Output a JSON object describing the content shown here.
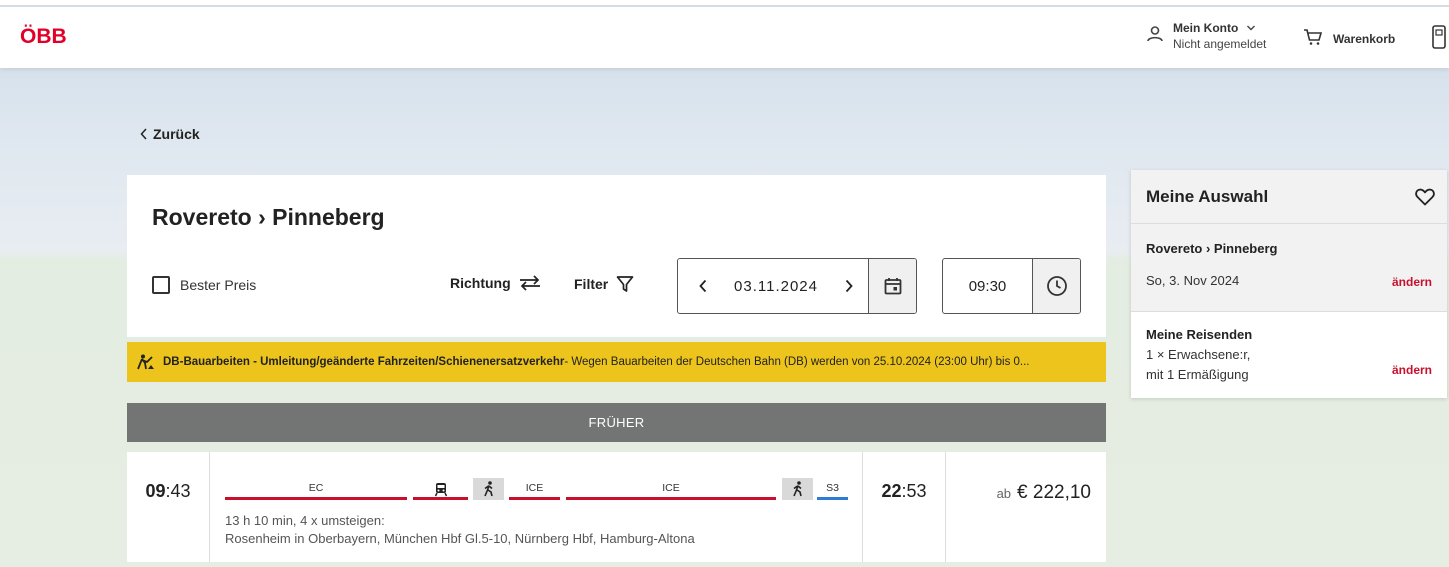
{
  "header": {
    "logo": "ÖBB",
    "account_label": "Mein Konto",
    "account_status": "Nicht angemeldet",
    "cart_label": "Warenkorb"
  },
  "nav": {
    "back_label": "Zurück"
  },
  "search": {
    "route_title": "Rovereto › Pinneberg",
    "best_price_label": "Bester Preis",
    "direction_label": "Richtung",
    "filter_label": "Filter",
    "date": "03.11.2024",
    "time": "09:30"
  },
  "alert": {
    "title": "DB-Bauarbeiten - Umleitung/geänderte Fahrzeiten/Schienenersatzverkehr",
    "text": " - Wegen Bauarbeiten der Deutschen Bahn (DB) werden von 25.10.2024 (23:00 Uhr) bis 0..."
  },
  "earlier_label": "FRÜHER",
  "connection": {
    "dep_hour": "09",
    "dep_min": ":43",
    "arr_hour": "22",
    "arr_min": ":53",
    "segments": [
      {
        "type": "train",
        "label": "EC",
        "color": "#c8102e"
      },
      {
        "type": "icon",
        "icon": "bus-icon",
        "color": "#c8102e"
      },
      {
        "type": "walk",
        "icon": "walk-icon"
      },
      {
        "type": "train",
        "label": "ICE",
        "color": "#c8102e"
      },
      {
        "type": "train",
        "label": "ICE",
        "color": "#c8102e"
      },
      {
        "type": "walk",
        "icon": "walk-icon"
      },
      {
        "type": "train",
        "label": "S3",
        "color": "#2f7bd1"
      }
    ],
    "duration_text": "13 h 10 min, 4 x umsteigen:",
    "via_text": "Rosenheim in Oberbayern, München Hbf Gl.5-10, Nürnberg Hbf, Hamburg-Altona",
    "price_prefix": "ab",
    "price": "€ 222,10"
  },
  "aside": {
    "title": "Meine Auswahl",
    "route": "Rovereto › Pinneberg",
    "date": "So, 3. Nov 2024",
    "change_label": "ändern",
    "travellers_title": "Meine Reisenden",
    "travellers_line1": "1 × Erwachsene:r,",
    "travellers_line2": "mit 1 Ermäßigung",
    "change_label2": "ändern"
  }
}
